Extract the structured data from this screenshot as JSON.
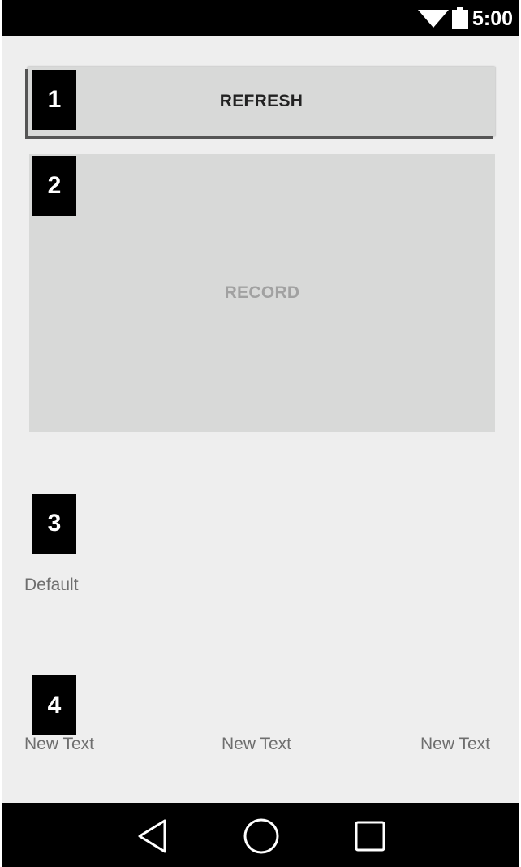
{
  "status_bar": {
    "time": "5:00",
    "icons": [
      "wifi-icon",
      "battery-icon"
    ]
  },
  "buttons": {
    "refresh_label": "REFRESH",
    "record_label": "RECORD"
  },
  "markers": [
    "1",
    "2",
    "3",
    "4"
  ],
  "texts": {
    "default_label": "Default",
    "new_text_items": [
      "New Text",
      "New Text",
      "New Text"
    ]
  },
  "nav_bar": {
    "icons": [
      "back-icon",
      "home-icon",
      "recent-apps-icon"
    ]
  },
  "colors": {
    "background": "#eeeeee",
    "button": "#d8d9d8",
    "bars": "#000000",
    "secondary_text": "#6e6e6e"
  }
}
